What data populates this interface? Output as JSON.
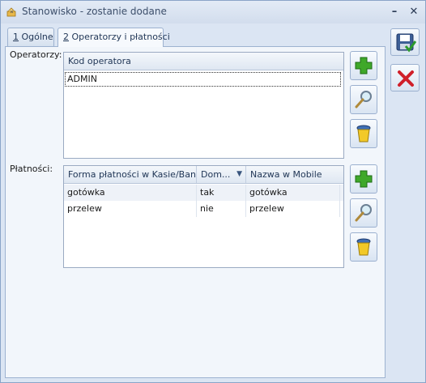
{
  "window": {
    "title": "Stanowisko - zostanie dodane",
    "minimize_label": "–",
    "close_label": "✕"
  },
  "tabs": [
    {
      "mnemonic": "1",
      "label": " Ogólne",
      "active": false
    },
    {
      "mnemonic": "2",
      "label": " Operatorzy i płatności",
      "active": true
    }
  ],
  "operators": {
    "label": "Operatorzy:",
    "columns": [
      "Kod operatora"
    ],
    "rows": [
      [
        "ADMIN"
      ]
    ]
  },
  "payments": {
    "label": "Płatności:",
    "columns": [
      "Forma płatności w Kasie/Banku",
      "Dom...",
      "Nazwa w Mobile"
    ],
    "rows": [
      [
        "gotówka",
        "tak",
        "gotówka"
      ],
      [
        "przelew",
        "nie",
        "przelew"
      ]
    ]
  },
  "icons": {
    "app": "app-icon",
    "save": "save-icon",
    "cancel": "cancel-icon",
    "add": "add-icon",
    "edit": "magnifier-icon",
    "delete": "trash-icon"
  },
  "colors": {
    "accent": "#3a8f1e",
    "cancel_red": "#d0202a",
    "window_bg": "#dbe5f3"
  }
}
